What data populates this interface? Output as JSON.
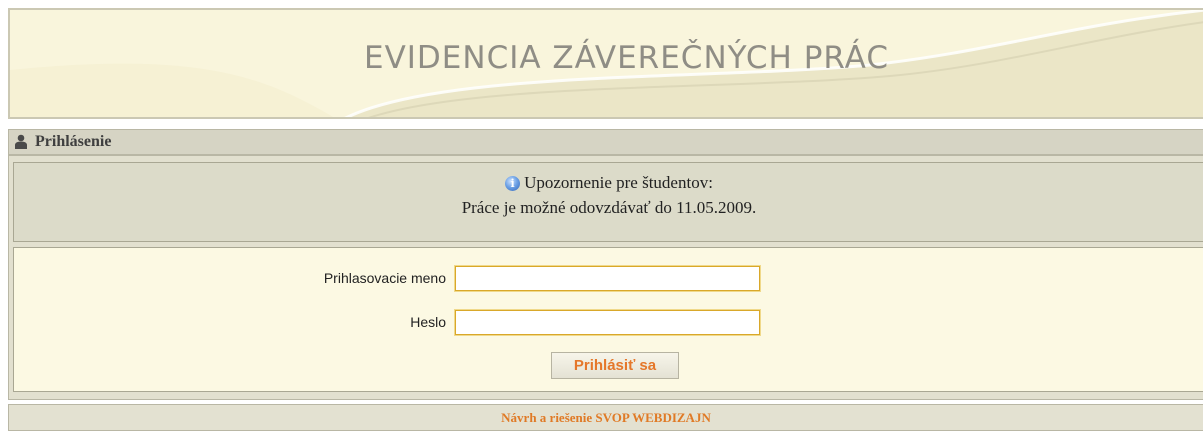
{
  "header": {
    "title": "EVIDENCIA ZÁVEREČNÝCH PRÁC"
  },
  "login_panel": {
    "title": "Prihlásenie",
    "icon": "user-icon",
    "notice": {
      "icon": "info-icon",
      "heading": "Upozornenie pre študentov:",
      "message": "Práce je možné odovzdávať do 11.05.2009."
    },
    "username_label": "Prihlasovacie meno",
    "username_value": "",
    "password_label": "Heslo",
    "password_value": "",
    "submit_label": "Prihlásiť sa"
  },
  "footer": {
    "credit": "Návrh a riešenie SVOP WEBDIZAJN"
  },
  "colors": {
    "header_bg": "#f9f5dc",
    "panel_bg": "#e2e0cf",
    "accent_orange": "#e5772a",
    "input_border": "#d9a82a"
  }
}
